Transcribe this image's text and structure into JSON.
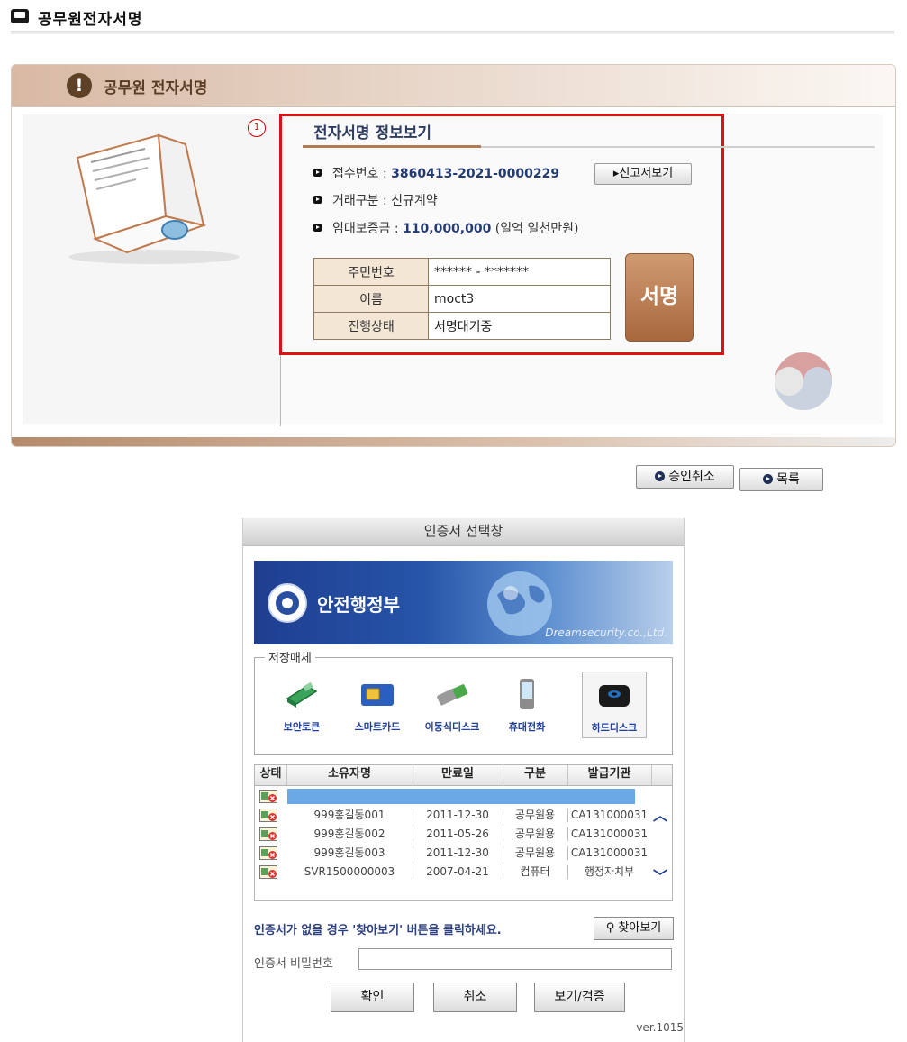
{
  "page": {
    "title": "공무원전자서명"
  },
  "panel": {
    "title": "공무원 전자서명",
    "badge": "1",
    "section_title": "전자서명 정보보기",
    "info": [
      {
        "label": "접수번호 : ",
        "value": "3860413-2021-0000229",
        "extra": ""
      },
      {
        "label": "거래구분 : 신규계약",
        "value": "",
        "extra": ""
      },
      {
        "label": "임대보증금 : ",
        "value": "110,000,000",
        "extra": " (일억 일천만원)"
      }
    ],
    "report_button": "신고서보기",
    "sign_table": [
      {
        "label": "주민번호",
        "value": "****** - *******"
      },
      {
        "label": "이름",
        "value": "moct3"
      },
      {
        "label": "진행상태",
        "value": "서명대기중"
      }
    ],
    "sign_button": "서명"
  },
  "actions": {
    "cancel_approval": "승인취소",
    "list": "목록"
  },
  "dialog": {
    "title": "인증서 선택창",
    "banner_name": "안전행정부",
    "banner_company": "Dreamsecurity.co.,Ltd.",
    "storage_legend": "저장매체",
    "storage": [
      {
        "label": "보안토큰",
        "icon": "security-token-icon"
      },
      {
        "label": "스마트카드",
        "icon": "smartcard-icon"
      },
      {
        "label": "이동식디스크",
        "icon": "usb-disk-icon"
      },
      {
        "label": "휴대전화",
        "icon": "mobile-phone-icon"
      },
      {
        "label": "하드디스크",
        "icon": "hard-disk-icon"
      }
    ],
    "columns": [
      "상태",
      "소유자명",
      "만료일",
      "구분",
      "발급기관"
    ],
    "rows": [
      {
        "owner": "",
        "expiry": "",
        "type": "",
        "issuer": "",
        "selected": true
      },
      {
        "owner": "999홍길동001",
        "expiry": "2011-12-30",
        "type": "공무원용",
        "issuer": "CA131000031",
        "selected": false
      },
      {
        "owner": "999홍길동002",
        "expiry": "2011-05-26",
        "type": "공무원용",
        "issuer": "CA131000031",
        "selected": false
      },
      {
        "owner": "999홍길동003",
        "expiry": "2011-12-30",
        "type": "공무원용",
        "issuer": "CA131000031",
        "selected": false
      },
      {
        "owner": "SVR1500000003",
        "expiry": "2007-04-21",
        "type": "컴퓨터",
        "issuer": "행정자치부",
        "selected": false
      }
    ],
    "notice": "인증서가 없을 경우 '찾아보기' 버튼을 클릭하세요.",
    "find_button": "찾아보기",
    "password_label": "인증서 비밀번호",
    "password_value": "",
    "ok_button": "확인",
    "cancel_button": "취소",
    "view_verify_button": "보기/검증",
    "version": "ver.1015"
  },
  "colors": {
    "accent_brown": "#a8683e",
    "highlight_red": "#e01010",
    "navy_text": "#243a73",
    "selection_blue": "#6aa8e6"
  }
}
